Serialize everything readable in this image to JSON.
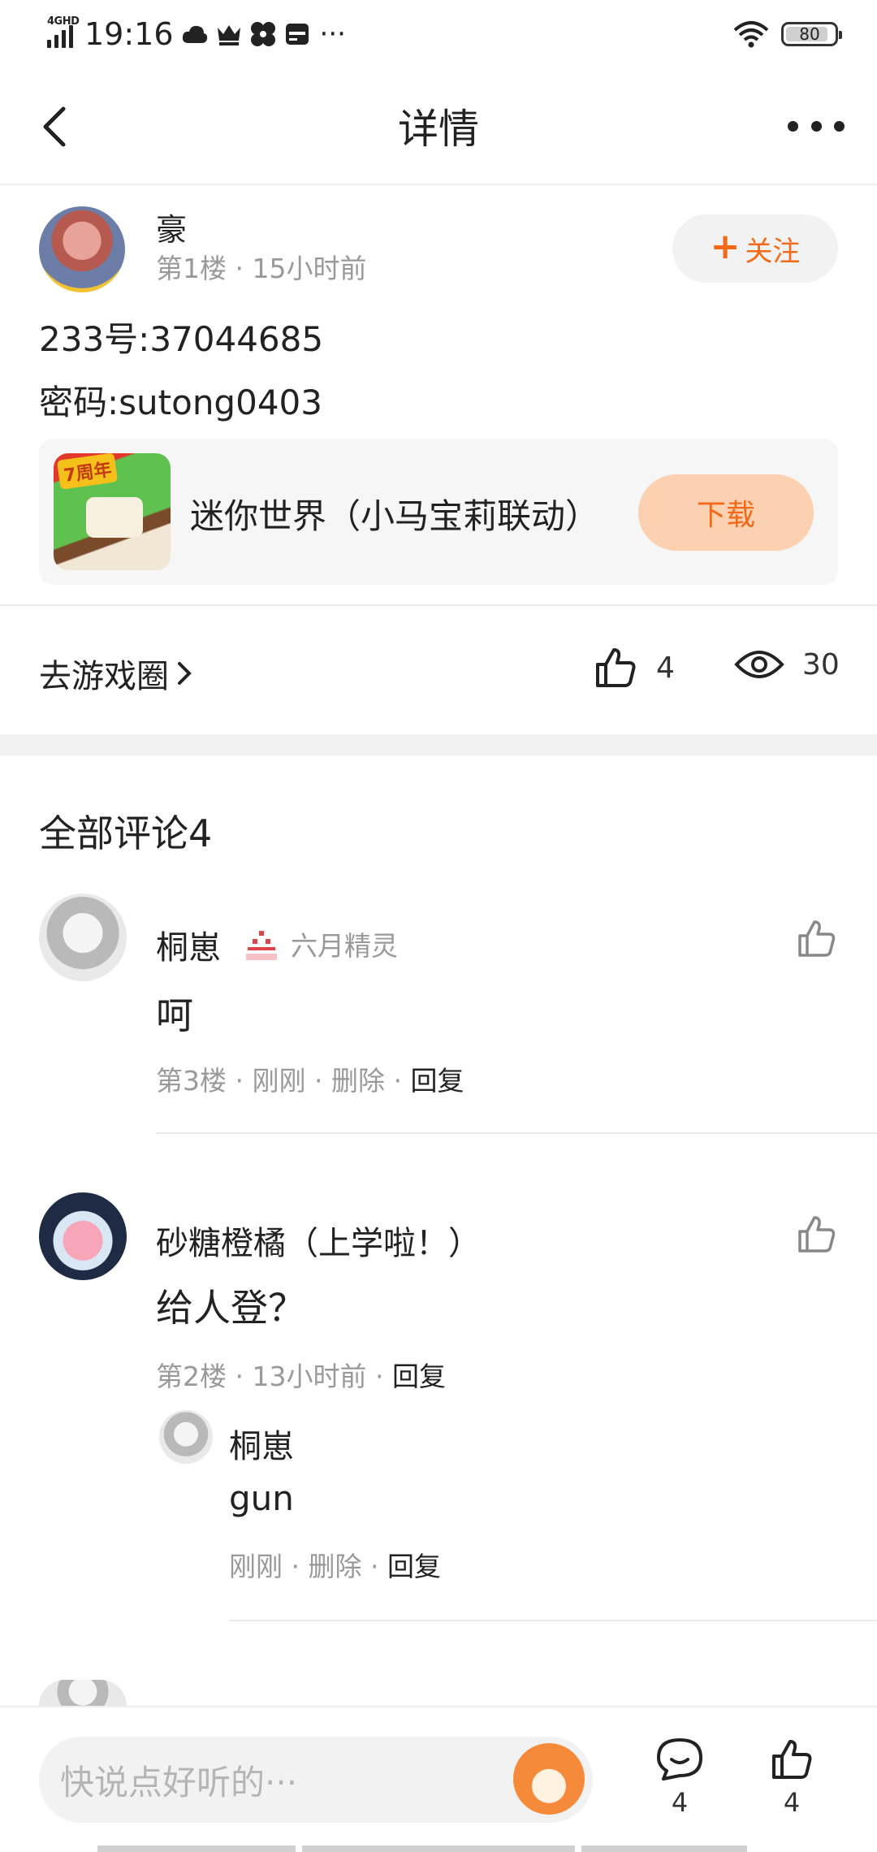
{
  "status_bar": {
    "network": "4GHD",
    "time": "19:16",
    "battery": "80",
    "overflow": "···"
  },
  "nav": {
    "title": "详情"
  },
  "post": {
    "author": "豪",
    "floor": "第1楼",
    "time": "15小时前",
    "follow_label": "关注",
    "line1": "233号:37044685",
    "line2": "密码:sutong0403",
    "game": {
      "icon_badge": "7周年",
      "name": "迷你世界（小马宝莉联动）",
      "download_label": "下载"
    },
    "go_circle_label": "去游戏圈",
    "likes": "4",
    "views": "30"
  },
  "comments": {
    "title": "全部评论4",
    "items": [
      {
        "name": "桐崽",
        "badge": "六月精灵",
        "text": "呵",
        "floor": "第3楼",
        "time": "刚刚",
        "delete": "删除",
        "reply": "回复"
      },
      {
        "name": "砂糖橙橘（上学啦！）",
        "text": "给人登？",
        "floor": "第2楼",
        "time": "13小时前",
        "reply": "回复",
        "sub_reply": {
          "name": "桐崽",
          "text": "gun",
          "time": "刚刚",
          "delete": "删除",
          "reply": "回复"
        }
      }
    ]
  },
  "bottom_bar": {
    "input_placeholder": "快说点好听的···",
    "comment_count": "4",
    "like_count": "4"
  },
  "icons": {
    "accent": "#f26a17"
  }
}
